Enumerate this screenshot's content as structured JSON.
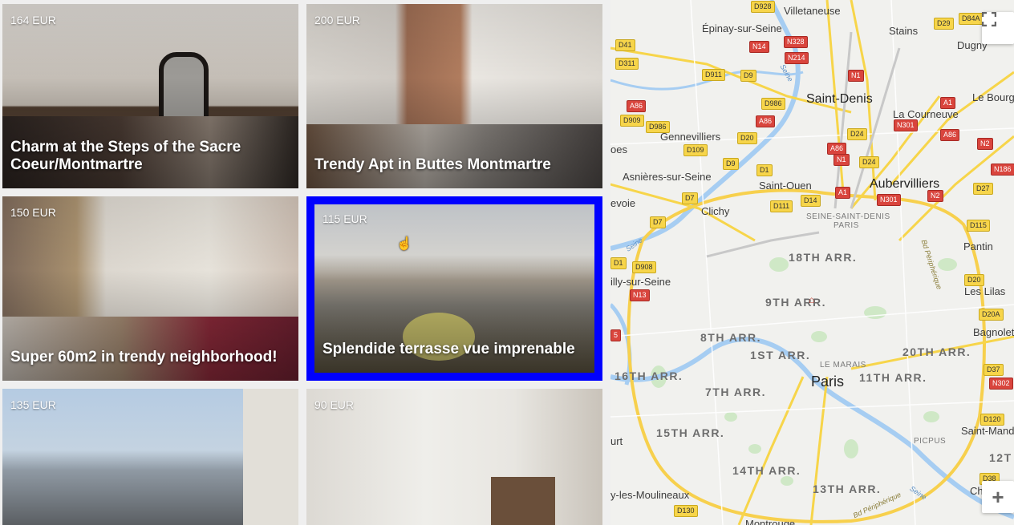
{
  "listings": [
    {
      "price": "164 EUR",
      "title": "Charm at the Steps of the Sacre Coeur/Montmartre",
      "selected": false
    },
    {
      "price": "200 EUR",
      "title": "Trendy Apt in Buttes Montmartre",
      "selected": false
    },
    {
      "price": "150 EUR",
      "title": "Super 60m2 in trendy neighborhood!",
      "selected": false
    },
    {
      "price": "115 EUR",
      "title": "Splendide terrasse vue imprenable",
      "selected": true
    },
    {
      "price": "135 EUR",
      "title": "",
      "selected": false
    },
    {
      "price": "90 EUR",
      "title": "",
      "selected": false
    }
  ],
  "colors": {
    "selected_border": "#0000ff"
  },
  "map": {
    "places": {
      "villetaneuse": "Villetaneuse",
      "epinay": "Épinay-sur-Seine",
      "stains": "Stains",
      "dugny": "Dugny",
      "saint_denis": "Saint-Denis",
      "le_bourget": "Le Bourg",
      "la_courneuve": "La Courneuve",
      "gennevilliers": "Gennevilliers",
      "asnieres": "Asnières-sur-Seine",
      "aubervilliers": "Aubervilliers",
      "saint_ouen": "Saint-Ouen",
      "clichy": "Clichy",
      "seine_saint_denis": "SEINE-SAINT-DENIS",
      "paris_dept": "PARIS",
      "pantin": "Pantin",
      "les_lilas": "Les Lilas",
      "bagnolet": "Bagnolet",
      "paris": "Paris",
      "le_marais": "LE MARAIS",
      "picpus": "PICPUS",
      "saint_mande": "Saint-Mandé",
      "charenton": "Charenton",
      "neuilly": "illy-sur-Seine",
      "levallois": "evoie",
      "colombes": "oes",
      "boulogne": "urt",
      "issy": "y-les-Moulineaux",
      "montrouge": "Montrouge"
    },
    "arrondissements": {
      "a18": "18TH ARR.",
      "a9": "9TH ARR.",
      "a8": "8TH ARR.",
      "a1": "1ST ARR.",
      "a20": "20TH ARR.",
      "a11": "11TH ARR.",
      "a16": "16TH ARR.",
      "a7": "7TH ARR.",
      "a15": "15TH ARR.",
      "a14": "14TH ARR.",
      "a13": "13TH ARR.",
      "a12": "12T"
    },
    "rivers": {
      "seine1": "Seine",
      "seine2": "Seine",
      "bd_periph": "Bd Périphérique",
      "bd_periph2": "Bd Périphérique",
      "seine3": "Seine"
    },
    "shields": {
      "d928": "D928",
      "d84a": "D84A",
      "d29": "D29",
      "d41": "D41",
      "n14": "N14",
      "n328": "N328",
      "n214": "N214",
      "d311": "D311",
      "d911": "D911",
      "d9a": "D9",
      "n1": "N1",
      "a86a": "A86",
      "d986": "D986",
      "a1a": "A1",
      "d909": "D909",
      "d986b": "D986",
      "a86b": "A86",
      "n301": "N301",
      "a86c": "A86",
      "n2a": "N2",
      "d20": "D20",
      "d109": "D109",
      "d24": "D24",
      "a86d": "A86",
      "d9b": "D9",
      "n1b": "N1",
      "d24b": "D24",
      "n186": "N186",
      "d1": "D1",
      "a1b": "A1",
      "d7a": "D7",
      "d111": "D111",
      "d14": "D14",
      "n301b": "N301",
      "n2b": "N2",
      "d27": "D27",
      "d7b": "D7",
      "d115": "D115",
      "d1b": "D1",
      "d908": "D908",
      "n13": "N13",
      "d20b": "D20",
      "d20a": "D20A",
      "d37": "D37",
      "n302": "N302",
      "d120": "D120",
      "d38": "D38",
      "d130": "D130",
      "d5": "5"
    },
    "fullscreen_icon": "fullscreen-icon",
    "zoom_in_icon": "zoom-in-icon",
    "zoom_in_label": "+"
  }
}
